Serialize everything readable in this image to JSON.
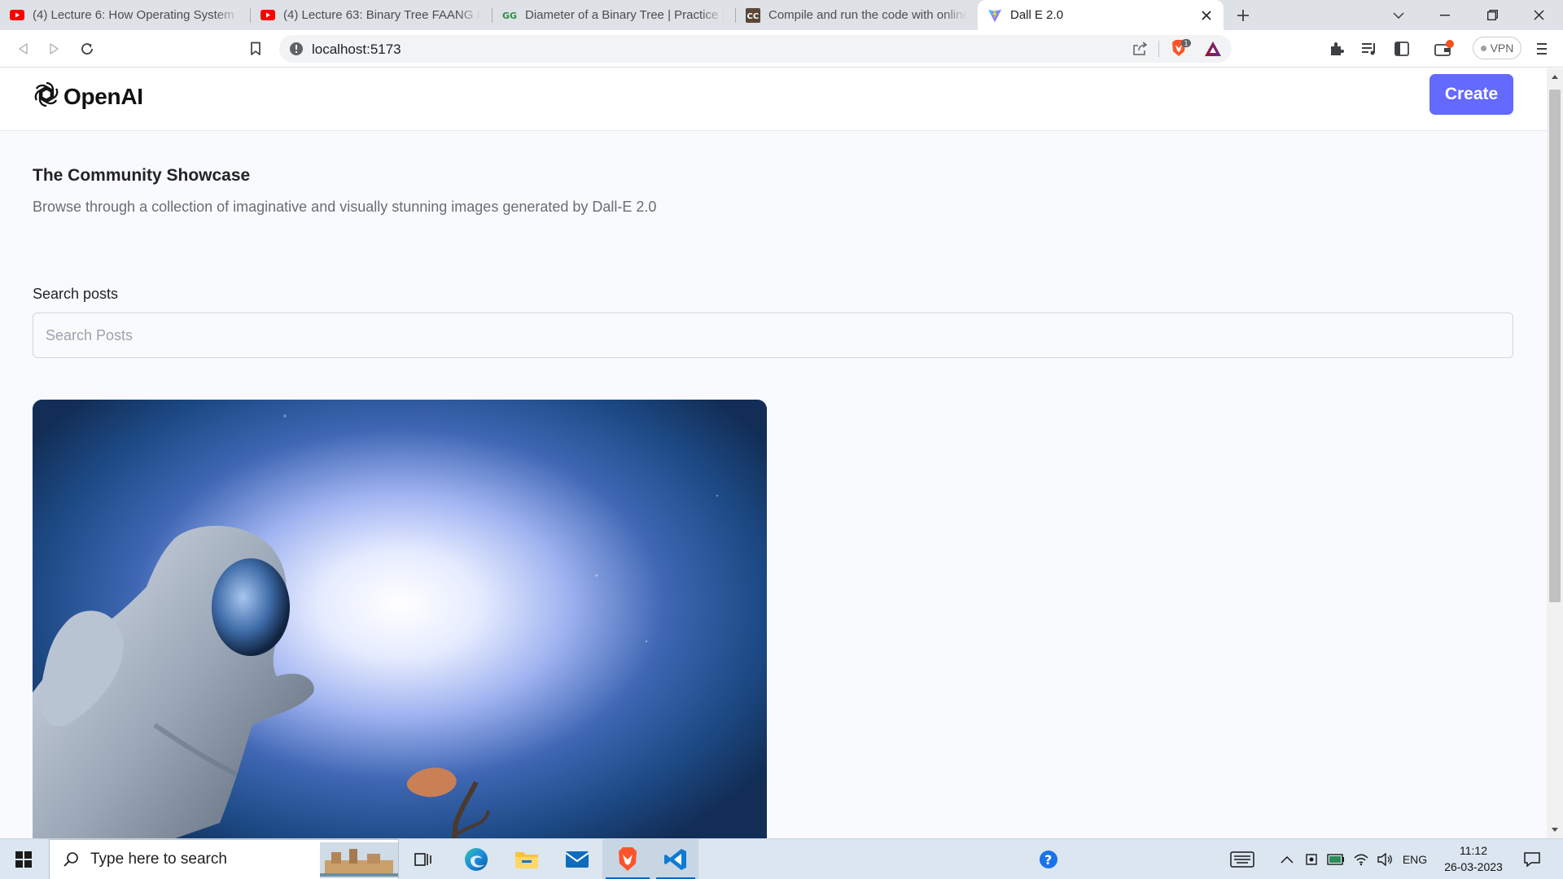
{
  "browser": {
    "tabs": [
      {
        "title": "(4) Lecture 6: How Operating System E",
        "icon": "youtube-icon"
      },
      {
        "title": "(4) Lecture 63: Binary Tree FAANG Inte",
        "icon": "youtube-icon"
      },
      {
        "title": "Diameter of a Binary Tree | Practice | G",
        "icon": "geeksforgeeks-icon"
      },
      {
        "title": "Compile and run the code with online",
        "icon": "codechef-icon"
      },
      {
        "title": "Dall E 2.0",
        "icon": "vite-icon",
        "active": true
      }
    ],
    "url": "localhost:5173",
    "vpn_label": "VPN",
    "brave_shield_count": "1"
  },
  "site": {
    "brand": "OpenAI",
    "create_label": "Create"
  },
  "showcase": {
    "title": "The Community Showcase",
    "subtitle": "Browse through a collection of imaginative and visually stunning images generated by Dall-E 2.0",
    "search_label": "Search posts",
    "search_placeholder": "Search Posts"
  },
  "taskbar": {
    "search_placeholder": "Type here to search",
    "language": "ENG",
    "time": "11:12",
    "date": "26-03-2023"
  },
  "colors": {
    "accent": "#6469ff",
    "page_bg": "#f9fafe",
    "taskbar_bg": "#dbe6f0"
  }
}
